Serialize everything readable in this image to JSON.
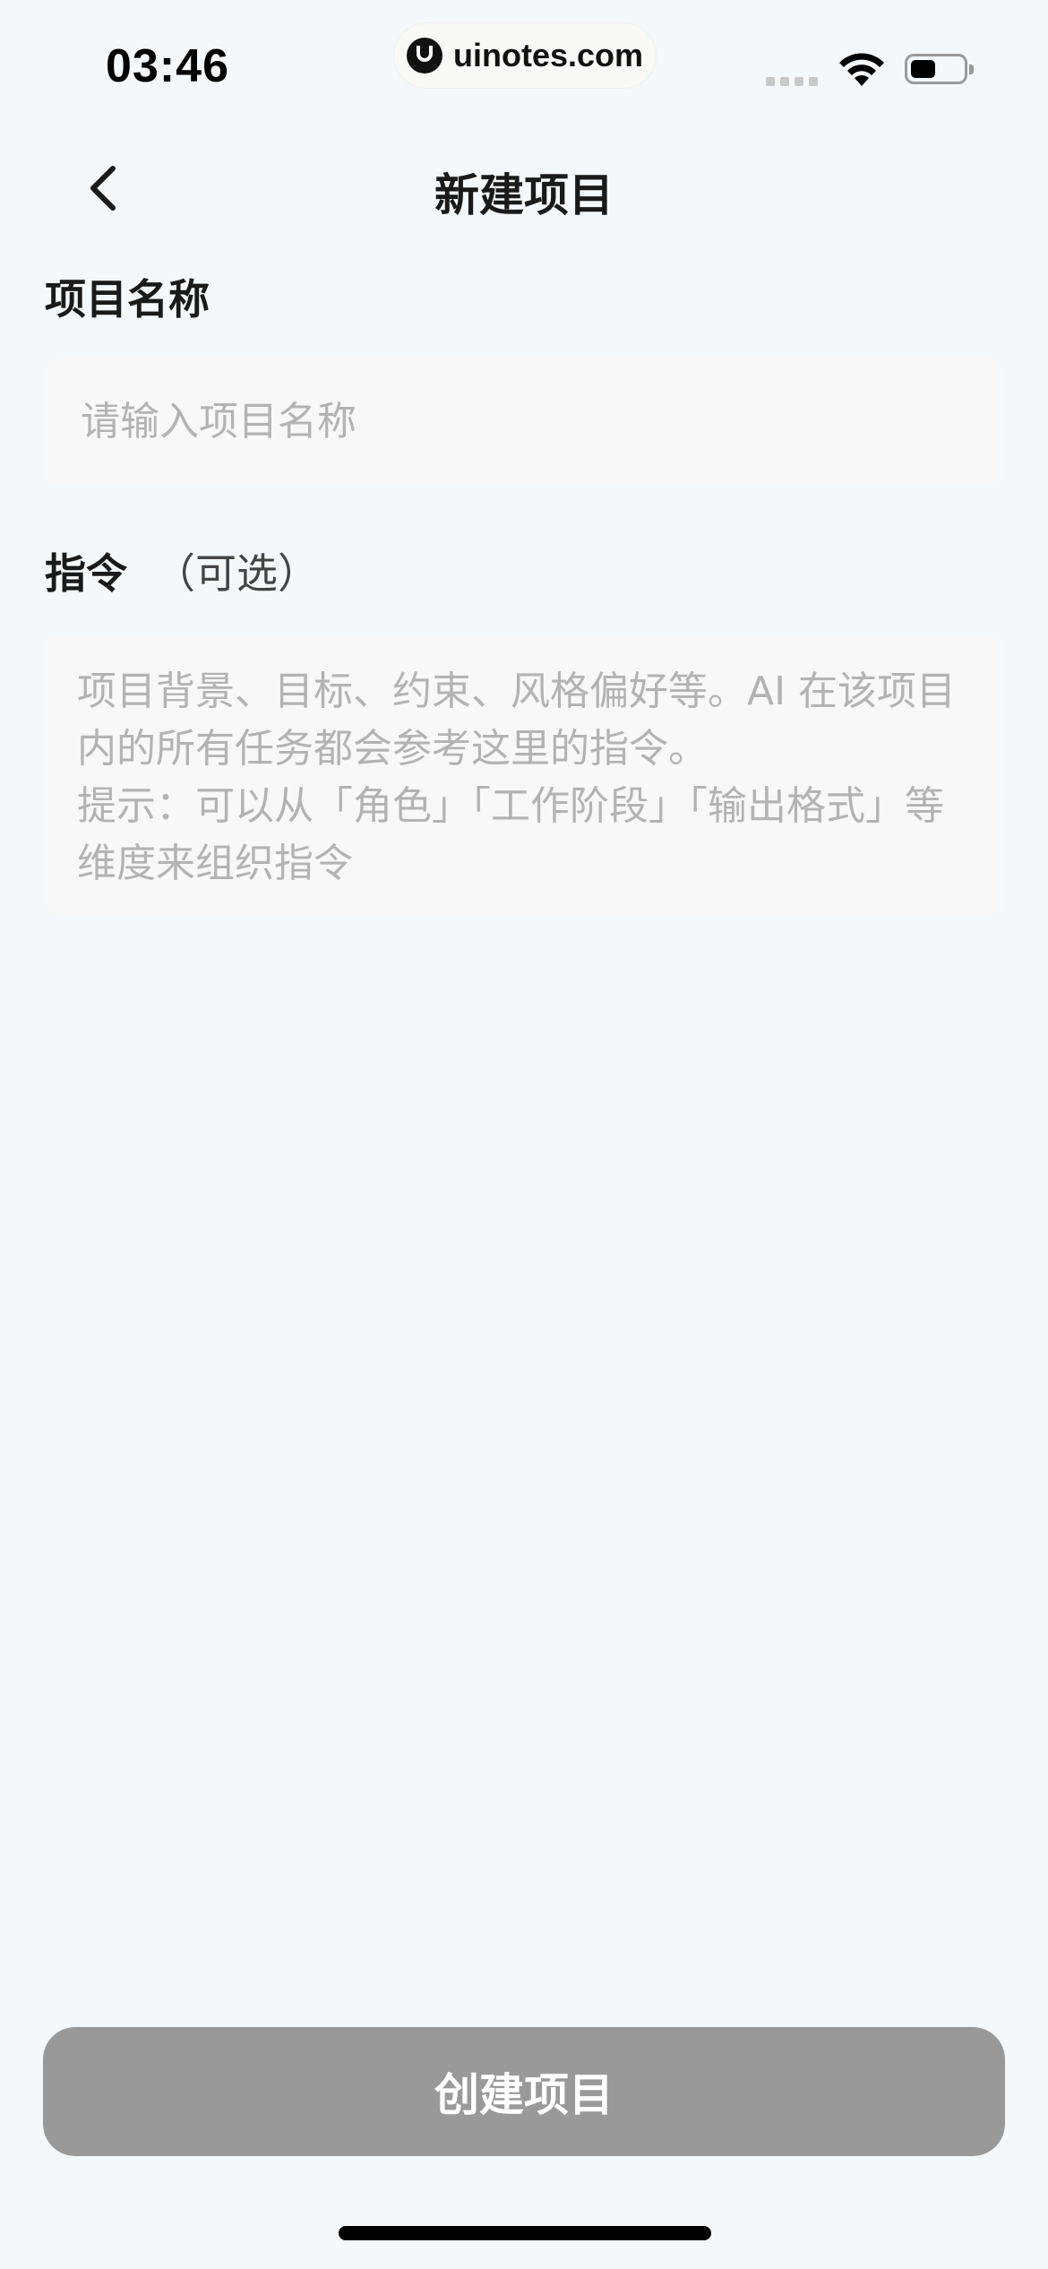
{
  "status_bar": {
    "time": "03:46",
    "url": "uinotes.com"
  },
  "nav": {
    "title": "新建项目"
  },
  "form": {
    "name_label": "项目名称",
    "name_placeholder": "请输入项目名称",
    "instruction_label": "指令",
    "instruction_optional": "（可选）",
    "instruction_placeholder": "项目背景、目标、约束、风格偏好等。AI 在该项目内的所有任务都会参考这里的指令。\n提示：可以从「角色」「工作阶段」「输出格式」等维度来组织指令"
  },
  "footer": {
    "create_label": "创建项目"
  },
  "colors": {
    "background": "#f5f8fa",
    "button_disabled": "#999999",
    "placeholder": "#b3b3b3"
  }
}
